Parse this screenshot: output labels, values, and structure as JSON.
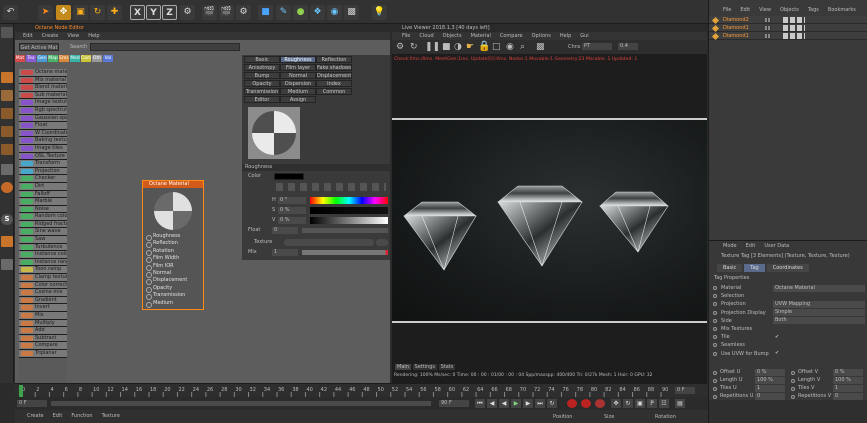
{
  "toolbar": {
    "icons": [
      "undo-icon",
      "live-select-icon",
      "move-icon",
      "scale-icon",
      "rotate-icon",
      "add-icon",
      "x-axis-icon",
      "y-axis-icon",
      "z-axis-icon",
      "coordinate-system-icon",
      "render-view-icon",
      "render-picture-viewer-icon",
      "render-settings-icon",
      "cube-icon",
      "pen-icon",
      "subdivision-icon",
      "array-icon",
      "environment-icon",
      "camera-icon",
      "light-icon"
    ],
    "x_label": "X",
    "y_label": "Y",
    "z_label": "Z"
  },
  "node_editor": {
    "title": "Octane Node Editor",
    "menu": [
      "Edit",
      "Create",
      "View",
      "Help"
    ],
    "get_active": "Get Active Mat",
    "search_label": "Search",
    "tags": [
      "Mat",
      "Tex",
      "Gen",
      "Map",
      "Ems",
      "Med",
      "Cam",
      "Oth",
      "Vol"
    ],
    "tag_colors": [
      "#d24a4a",
      "#8a5cd6",
      "#4a9ad6",
      "#4ab36a",
      "#d68a3a",
      "#39b3a6",
      "#c9c33a",
      "#999999",
      "#5a79d6"
    ],
    "nodes": [
      {
        "label": "Octane material",
        "color": "#c94b4b"
      },
      {
        "label": "Mix material",
        "color": "#c94b4b"
      },
      {
        "label": "Blend material",
        "color": "#c94b4b"
      },
      {
        "label": "Sub material",
        "color": "#c94b4b"
      },
      {
        "label": "Image texture",
        "color": "#8754c9"
      },
      {
        "label": "Rgb spectrum",
        "color": "#8754c9"
      },
      {
        "label": "Gaussian spectrum",
        "color": "#8754c9"
      },
      {
        "label": "Float",
        "color": "#8754c9"
      },
      {
        "label": "W Coordinate",
        "color": "#8754c9"
      },
      {
        "label": "Baking texture",
        "color": "#8754c9"
      },
      {
        "label": "Image tiles",
        "color": "#8754c9"
      },
      {
        "label": "OSL Texture",
        "color": "#8754c9"
      },
      {
        "label": "Transform",
        "color": "#46a7c9"
      },
      {
        "label": "Projection",
        "color": "#46a7c9"
      },
      {
        "label": "Checker",
        "color": "#4aad64"
      },
      {
        "label": "Dirt",
        "color": "#4aad64"
      },
      {
        "label": "Falloff",
        "color": "#4aad64"
      },
      {
        "label": "Marble",
        "color": "#4aad64"
      },
      {
        "label": "Noise",
        "color": "#4aad64"
      },
      {
        "label": "Random color",
        "color": "#4aad64"
      },
      {
        "label": "Ridged fractal",
        "color": "#4aad64"
      },
      {
        "label": "Sine wave",
        "color": "#4aad64"
      },
      {
        "label": "Saw",
        "color": "#4aad64"
      },
      {
        "label": "Turbulence",
        "color": "#4aad64"
      },
      {
        "label": "Instance color",
        "color": "#4aad64"
      },
      {
        "label": "Instance range",
        "color": "#4aad64"
      },
      {
        "label": "Toon ramp",
        "color": "#c9b94a"
      },
      {
        "label": "Clamp texture",
        "color": "#c97a46"
      },
      {
        "label": "Color correction",
        "color": "#c97a46"
      },
      {
        "label": "Cosine mix",
        "color": "#c97a46"
      },
      {
        "label": "Gradient",
        "color": "#c97a46"
      },
      {
        "label": "Invert",
        "color": "#c97a46"
      },
      {
        "label": "Mix",
        "color": "#c97a46"
      },
      {
        "label": "Multiply",
        "color": "#c97a46"
      },
      {
        "label": "Add",
        "color": "#c97a46"
      },
      {
        "label": "Subtract",
        "color": "#c97a46"
      },
      {
        "label": "Compare",
        "color": "#c97a46"
      },
      {
        "label": "Triplanar",
        "color": "#c97a46"
      }
    ],
    "node_card": {
      "title": "Octane Material",
      "pins": [
        "Roughness",
        "Reflection",
        "Rotation",
        "Film Width",
        "Film IOR",
        "Normal",
        "Displacement",
        "Opacity",
        "Transmission",
        "Medium"
      ]
    }
  },
  "material_panel": {
    "tabs": [
      "Basic",
      "Roughness",
      "Reflection",
      "Anisotropy",
      "Film layer",
      "Fake shadows",
      "Bump",
      "Normal",
      "Displacement",
      "Opacity",
      "Dispersion",
      "Index",
      "Transmission",
      "Medium",
      "Common",
      "Editor",
      "Assign"
    ],
    "active_tab": "Roughness",
    "section": "Roughness",
    "color_label": "Color",
    "h_label": "H",
    "h_value": "0 °",
    "s_label": "S",
    "s_value": "0 %",
    "v_label": "V",
    "v_value": "0 %",
    "float_label": "Float",
    "float_value": "0",
    "texture_label": "Texture",
    "mix_label": "Mix",
    "mix_value": "1",
    "swatch_color": "#000000"
  },
  "live_viewer": {
    "title": "Live Viewer 2018.1.3 [40 days left]",
    "menu": [
      "File",
      "Cloud",
      "Objects",
      "Material",
      "Compare",
      "Options",
      "Help",
      "Gui"
    ],
    "status_red": "Check:0ms./0ms. MeshGen:1ms. Update[O]:0ms. Nodes:1 Movable:1 Geometry:23 Marable: 1 Updated: 1",
    "channel_label": "Chns",
    "channel_value": "PT",
    "value_box": "0.4",
    "tabs": [
      "Main",
      "Settings",
      "Stats"
    ],
    "bottom_status": "Rendering: 100% Ms/sec: 0 Time: 00 : 00 : 01/00 : 00 : 04 Spp/maxspp: 400/400 Tri: 0/27k Mesh: 1 Hair: 0 GPU: 32"
  },
  "object_manager": {
    "menu": [
      "File",
      "Edit",
      "View",
      "Objects",
      "Tags",
      "Bookmarks"
    ],
    "items": [
      "Diamond2",
      "Diamond1",
      "Diamond1"
    ]
  },
  "attributes": {
    "menu": [
      "Mode",
      "Edit",
      "User Data"
    ],
    "title": "Texture Tag [3 Elements] (Texture, Texture, Texture)",
    "tabs": [
      "Basic",
      "Tag",
      "Coordinates"
    ],
    "active_tab": "Tag",
    "section": "Tag Properties",
    "rows": [
      {
        "label": "Material",
        "value": "Octane Material"
      },
      {
        "label": "Selection",
        "value": ""
      },
      {
        "label": "Projection",
        "value": "UVW Mapping"
      },
      {
        "label": "Projection Display",
        "value": "Simple"
      },
      {
        "label": "Side",
        "value": "Both"
      },
      {
        "label": "Mix Textures",
        "value": ""
      },
      {
        "label": "Tile",
        "value": "✔"
      },
      {
        "label": "Seamless",
        "value": ""
      },
      {
        "label": "Use UVW for Bump",
        "value": "✔"
      }
    ],
    "coords": [
      {
        "label": "Offset U",
        "value": "0 %"
      },
      {
        "label": "Offset V",
        "value": "0 %"
      },
      {
        "label": "Length U",
        "value": "100 %"
      },
      {
        "label": "Length V",
        "value": "100 %"
      },
      {
        "label": "Tiles U",
        "value": "1"
      },
      {
        "label": "Tiles V",
        "value": "1"
      },
      {
        "label": "Repetitions U",
        "value": "0"
      },
      {
        "label": "Repetitions V",
        "value": "0"
      }
    ]
  },
  "timeline": {
    "ticks": [
      "0",
      "2",
      "4",
      "6",
      "8",
      "10",
      "12",
      "14",
      "16",
      "18",
      "20",
      "22",
      "24",
      "26",
      "28",
      "30",
      "32",
      "34",
      "36",
      "38",
      "40",
      "42",
      "44",
      "46",
      "48",
      "50",
      "52",
      "54",
      "56",
      "58",
      "60",
      "62",
      "64",
      "66",
      "68",
      "70",
      "72",
      "74",
      "76",
      "78",
      "80",
      "82",
      "84",
      "86",
      "88",
      "90"
    ],
    "start_frame": "0 F",
    "end_frame": "90 F",
    "current_frame": "0 F",
    "right_frame": "0 F"
  },
  "bottom_menu": [
    "Create",
    "Edit",
    "Function",
    "Texture"
  ],
  "coord_headers": [
    "Position",
    "Size",
    "Rotation"
  ]
}
